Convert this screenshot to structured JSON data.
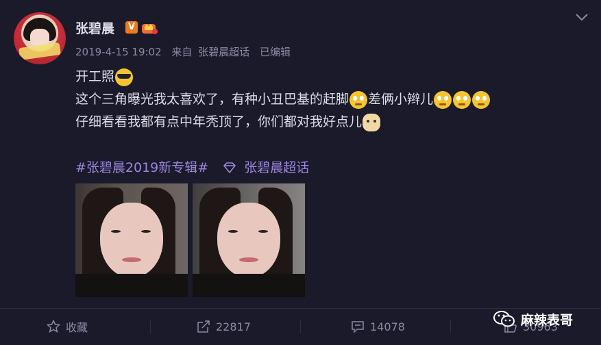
{
  "post": {
    "author": "张碧晨",
    "verified_badge": "V",
    "timestamp": "2019-4-15 19:02",
    "source_prefix": "来自",
    "source": "张碧晨超话",
    "edited": "已编辑",
    "lines": {
      "line1": "开工照",
      "line2a": "这个三角曝光我太喜欢了，有种小丑巴基的赶脚",
      "line2b": "差俩小辫儿",
      "line3": "仔细看看我都有点中年秃顶了，你们都对我好点儿"
    },
    "hashtag": "#张碧晨2019新专辑#",
    "super_topic": "张碧晨超话"
  },
  "actions": {
    "favorite_label": "收藏",
    "repost_count": "22817",
    "comment_count": "14078",
    "like_count": "30963"
  },
  "watermark": {
    "text": "麻辣表哥"
  },
  "colors": {
    "background": "#1b1a2b",
    "text": "#dedce8",
    "muted": "#8d8aa2",
    "link": "#9c87dc",
    "badge": "#ef7a1a"
  }
}
